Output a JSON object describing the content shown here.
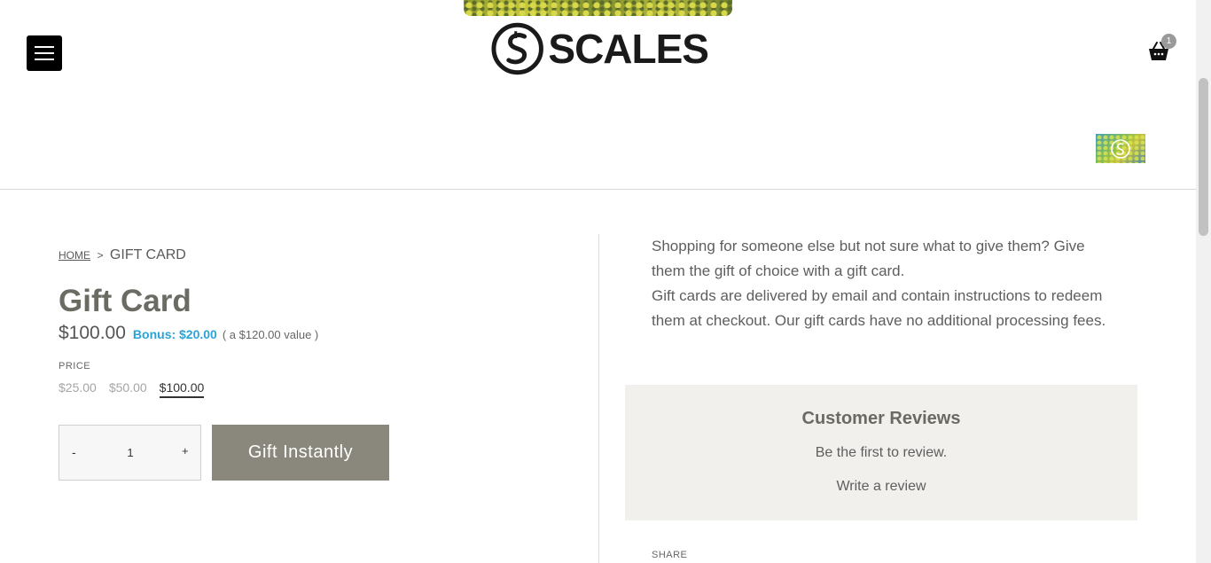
{
  "header": {
    "logo_text": "SCALES",
    "cart_count": "1"
  },
  "breadcrumb": {
    "home": "HOME",
    "separator": ">",
    "current": "GIFT CARD"
  },
  "product": {
    "title": "Gift Card",
    "price": "$100.00",
    "bonus": "Bonus: $20.00",
    "value_note": "( a $120.00 value )",
    "price_label": "PRICE",
    "options": [
      "$25.00",
      "$50.00",
      "$100.00"
    ],
    "selected_option": "$100.00",
    "quantity": {
      "minus": "-",
      "value": "1",
      "plus": "+"
    },
    "cta": "Gift Instantly"
  },
  "description": {
    "line1": "Shopping for someone else but not sure what to give them? Give them the gift of choice with a gift card.",
    "line2": "Gift cards are delivered by email and contain instructions to redeem them at checkout. Our gift cards have no additional processing fees."
  },
  "reviews": {
    "heading": "Customer Reviews",
    "empty_text": "Be the first to review.",
    "write_link": "Write a review"
  },
  "share_label": "SHARE",
  "colors": {
    "button_bg": "#8a877d",
    "bonus": "#2aa3d8",
    "reviews_bg": "#f2f0ed"
  }
}
